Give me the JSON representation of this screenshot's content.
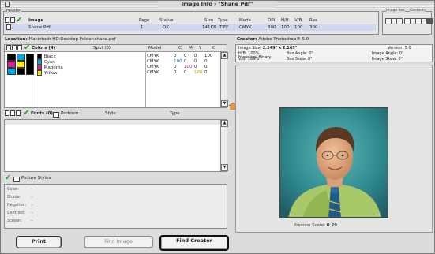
{
  "window": {
    "title": "Image Info - \"Shane Pdf\""
  },
  "header": {
    "group_label": "Header",
    "columns": [
      "Image",
      "Page",
      "Status",
      "Size",
      "Type",
      "Mode",
      "DPI",
      "H/B",
      "V/B",
      "Res"
    ],
    "row": [
      "Shane Pdf",
      "1",
      "OK",
      "141KB",
      "TIFF",
      "CMYK",
      "300",
      "100",
      "100",
      "300"
    ],
    "right_group_label_1": "Image Res",
    "right_group_label_2": "Contents"
  },
  "location": {
    "label": "Location:",
    "value": "Macintosh HD:Desktop Folder:shane.pdf"
  },
  "colors": {
    "title": "Colors (4)",
    "spot_label": "Spot (0)",
    "columns": [
      "Model",
      "C",
      "M",
      "Y",
      "K"
    ],
    "rows": [
      {
        "name": "Black",
        "model": "CMYK",
        "c": "0",
        "m": "0",
        "y": "0",
        "k": "100",
        "swatch": "#000000"
      },
      {
        "name": "Cyan",
        "model": "CMYK",
        "c": "100",
        "m": "0",
        "y": "0",
        "k": "0",
        "swatch": "#00a6e0"
      },
      {
        "name": "Magenta",
        "model": "CMYK",
        "c": "0",
        "m": "100",
        "y": "0",
        "k": "0",
        "swatch": "#d81f8a"
      },
      {
        "name": "Yellow",
        "model": "CMYK",
        "c": "0",
        "m": "0",
        "y": "100",
        "k": "0",
        "swatch": "#ffe800"
      }
    ]
  },
  "fonts": {
    "title": "Fonts (0)",
    "checkbox_label": "Problem",
    "col_style": "Style",
    "col_type": "Type"
  },
  "picture_styles": {
    "title": "Picture Styles",
    "rows": [
      {
        "label": "Color:",
        "value": "–"
      },
      {
        "label": "Shade:",
        "value": "–"
      },
      {
        "label": "Negative:",
        "value": "–"
      },
      {
        "label": "Contrast:",
        "value": "–"
      },
      {
        "label": "Screen:",
        "value": "–"
      }
    ]
  },
  "buttons": {
    "print": "Print",
    "find_image": "Find Image",
    "find_creator": "Find Creator"
  },
  "creator": {
    "label": "Creator:",
    "value": "Adobe Photoshop® 5.0"
  },
  "info": {
    "image_size_label": "Image Size:",
    "image_size_value": "2.149\" x 2.163\"",
    "version_label": "Version:",
    "version_value": "5.0",
    "hb_label": "H/B:",
    "hb_value": "100%",
    "box_angle_label": "Box Angle:",
    "box_angle_value": "0°",
    "image_angle_label": "Image Angle:",
    "image_angle_value": "0°",
    "vb_label": "V/B:",
    "vb_value": "100%",
    "box_skew_label": "Box Skew:",
    "box_skew_value": "0°",
    "image_skew_label": "Image Skew:",
    "image_skew_value": "0°",
    "encoding_label": "Encoding:",
    "encoding_value": "Binary"
  },
  "preview": {
    "label": "Preview Scale:",
    "value": "0.29"
  },
  "colors_palette": {
    "accent_green": "#2c9a2c",
    "selection_blue": "#cfd8f0"
  }
}
